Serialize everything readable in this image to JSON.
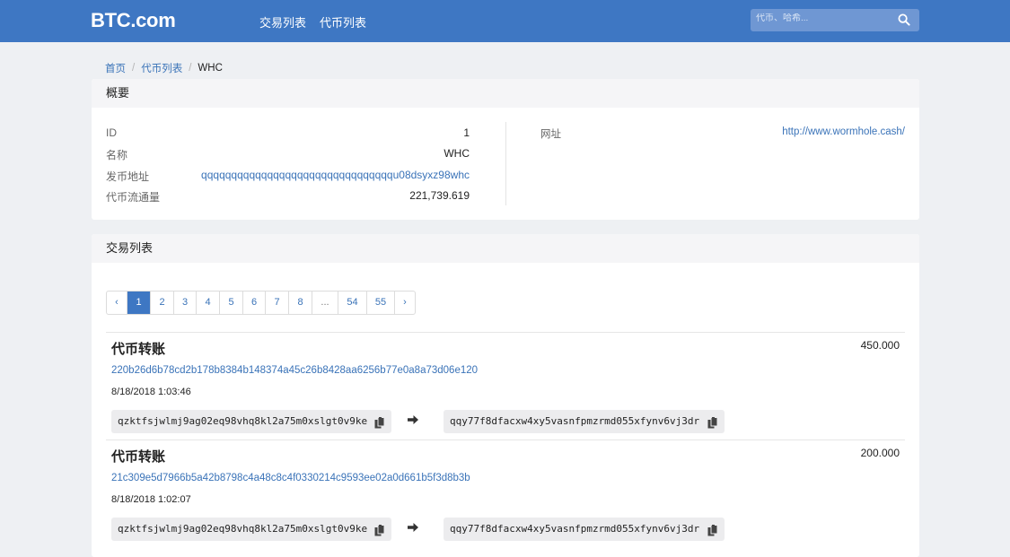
{
  "header": {
    "logo": "BTC.com",
    "nav": [
      "交易列表",
      "代币列表"
    ],
    "search_placeholder": "代币、哈希..."
  },
  "breadcrumb": {
    "home": "首页",
    "tokens": "代币列表",
    "current": "WHC"
  },
  "overview": {
    "title": "概要",
    "rows": [
      {
        "label": "ID",
        "value": "1"
      },
      {
        "label": "名称",
        "value": "WHC"
      },
      {
        "label": "发币地址",
        "value": "qqqqqqqqqqqqqqqqqqqqqqqqqqqqqqqqu08dsyxz98whc"
      },
      {
        "label": "代币流通量",
        "value": "221,739.619"
      }
    ],
    "website_label": "网址",
    "website_value": "http://www.wormhole.cash/"
  },
  "transactions": {
    "title": "交易列表",
    "pager": [
      "‹",
      "1",
      "2",
      "3",
      "4",
      "5",
      "6",
      "7",
      "8",
      "...",
      "54",
      "55",
      "›"
    ],
    "active_page": "1",
    "items": [
      {
        "type": "代币转账",
        "amount": "450.000",
        "hash": "220b26d6b78cd2b178b8384b148374a45c26b8428aa6256b77e0a8a73d06e120",
        "time": "8/18/2018 1:03:46",
        "from": "qzktfsjwlmj9ag02eq98vhq8kl2a75m0xslgt0v9ke",
        "to": "qqy77f8dfacxw4xy5vasnfpmzrmd055xfynv6vj3dr"
      },
      {
        "type": "代币转账",
        "amount": "200.000",
        "hash": "21c309e5d7966b5a42b8798c4a48c8c4f0330214c9593ee02a0d661b5f3d8b3b",
        "time": "8/18/2018 1:02:07",
        "from": "qzktfsjwlmj9ag02eq98vhq8kl2a75m0xslgt0v9ke",
        "to": "qqy77f8dfacxw4xy5vasnfpmzrmd055xfynv6vj3dr"
      }
    ]
  },
  "colors": {
    "brand": "#3e77c3",
    "link": "#3a73b8",
    "page_bg": "#eef0f3"
  },
  "icons": {
    "search": "search-icon",
    "copy": "copy-icon",
    "arrow": "arrow-right-icon"
  }
}
